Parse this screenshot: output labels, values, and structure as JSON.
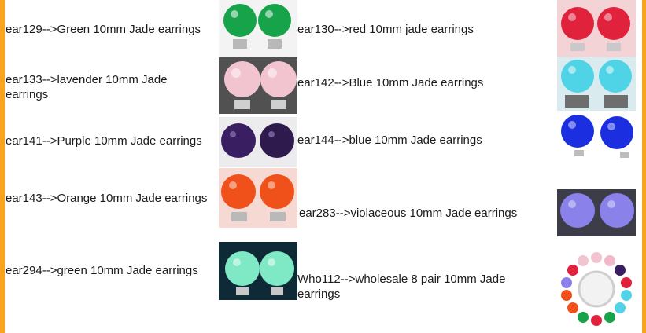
{
  "products": [
    {
      "label": "ear129-->Green 10mm Jade earrings",
      "icon": "green-jade-earrings-icon",
      "color": "#16a34a",
      "bg": "#f3f3f3"
    },
    {
      "label": "ear130-->red 10mm jade earrings",
      "icon": "red-jade-earrings-icon",
      "color": "#e0223c",
      "bg": "#f4d3d6"
    },
    {
      "label": "ear133-->lavender 10mm Jade earrings",
      "icon": "lavender-jade-earrings-icon",
      "color": "#f2c4cf",
      "bg": "#515151"
    },
    {
      "label": "ear142-->Blue 10mm Jade earrings",
      "icon": "blue-jade-earrings-icon",
      "color": "#4fd3e6",
      "bg": "#d9ebee"
    },
    {
      "label": "ear141-->Purple 10mm Jade earrings",
      "icon": "purple-jade-earrings-icon",
      "color": "#3a1e62",
      "bg": "#ececef"
    },
    {
      "label": "ear144-->blue 10mm Jade earrings",
      "icon": "dark-blue-jade-earrings-icon",
      "color": "#1b2ee0",
      "bg": "#ffffff"
    },
    {
      "label": "ear143-->Orange 10mm Jade earrings",
      "icon": "orange-jade-earrings-icon",
      "color": "#f0501a",
      "bg": "#f6d9d2"
    },
    {
      "label": "ear283-->violaceous 10mm Jade earrings",
      "icon": "violaceous-jade-earrings-icon",
      "color": "#8a82ea",
      "bg": "#3d3d4a"
    },
    {
      "label": "ear294-->green 10mm Jade earrings",
      "icon": "mint-jade-earrings-icon",
      "color": "#7fe8c4",
      "bg": "#0e2a36"
    },
    {
      "label": "Who112-->wholesale 8 pair 10mm Jade earrings",
      "icon": "assorted-jade-earrings-ring-icon",
      "color": "#ffffff",
      "bg": "#ffffff"
    }
  ]
}
